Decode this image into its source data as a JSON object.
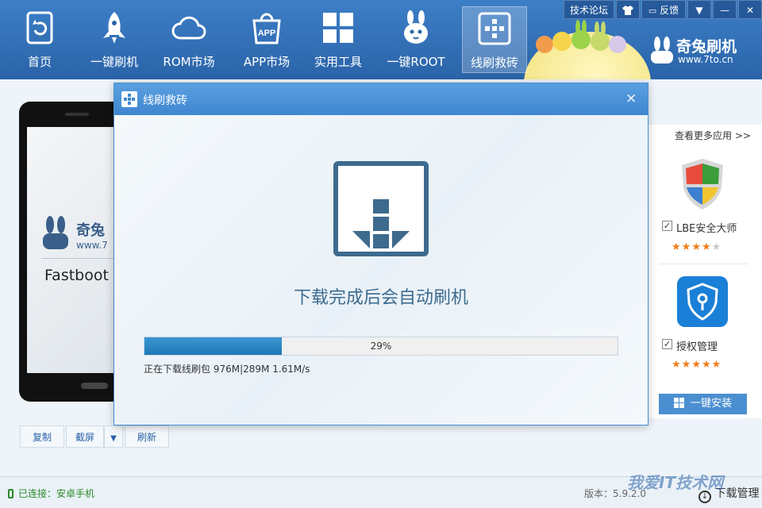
{
  "nav": {
    "items": [
      {
        "label": "首页",
        "icon": "refresh-square-icon"
      },
      {
        "label": "一键刷机",
        "icon": "rocket-icon"
      },
      {
        "label": "ROM市场",
        "icon": "cloud-icon"
      },
      {
        "label": "APP市场",
        "icon": "app-bag-icon"
      },
      {
        "label": "实用工具",
        "icon": "grid-icon"
      },
      {
        "label": "一键ROOT",
        "icon": "rabbit-icon"
      },
      {
        "label": "线刷救砖",
        "icon": "plus-square-icon"
      }
    ],
    "active_index": 6
  },
  "toolbar": {
    "forum": "技术论坛",
    "feedback": "反馈"
  },
  "logo": {
    "name": "奇兔刷机",
    "url": "www.7to.cn"
  },
  "phone": {
    "brand": "奇兔",
    "url": "www.7",
    "mode": "Fastboot"
  },
  "phone_actions": {
    "copy": "复制",
    "screenshot": "截屏",
    "refresh": "刷新"
  },
  "apps_panel": {
    "more": "查看更多应用 >>",
    "apps": [
      {
        "name": "LBE安全大师",
        "stars_on": 4,
        "stars_total": 5
      },
      {
        "name": "授权管理",
        "stars_on": 5,
        "stars_total": 5
      }
    ],
    "install_all": "一键安装",
    "star_glyph": "★"
  },
  "modal": {
    "title": "线刷救砖",
    "close": "×",
    "message": "下载完成后会自动刷机",
    "progress_percent": 29,
    "progress_label": "29%",
    "status": "正在下载线刷包 976M|289M 1.61M/s"
  },
  "statusbar": {
    "connection": "已连接：安卓手机",
    "version": "版本：5.9.2.0",
    "download_manager": "下载管理"
  },
  "watermark": "我爱IT技术网",
  "colors": {
    "header": "#2a63a8",
    "accent": "#1c78b8",
    "star": "#f07c1a",
    "connected": "#2a8a2a"
  }
}
